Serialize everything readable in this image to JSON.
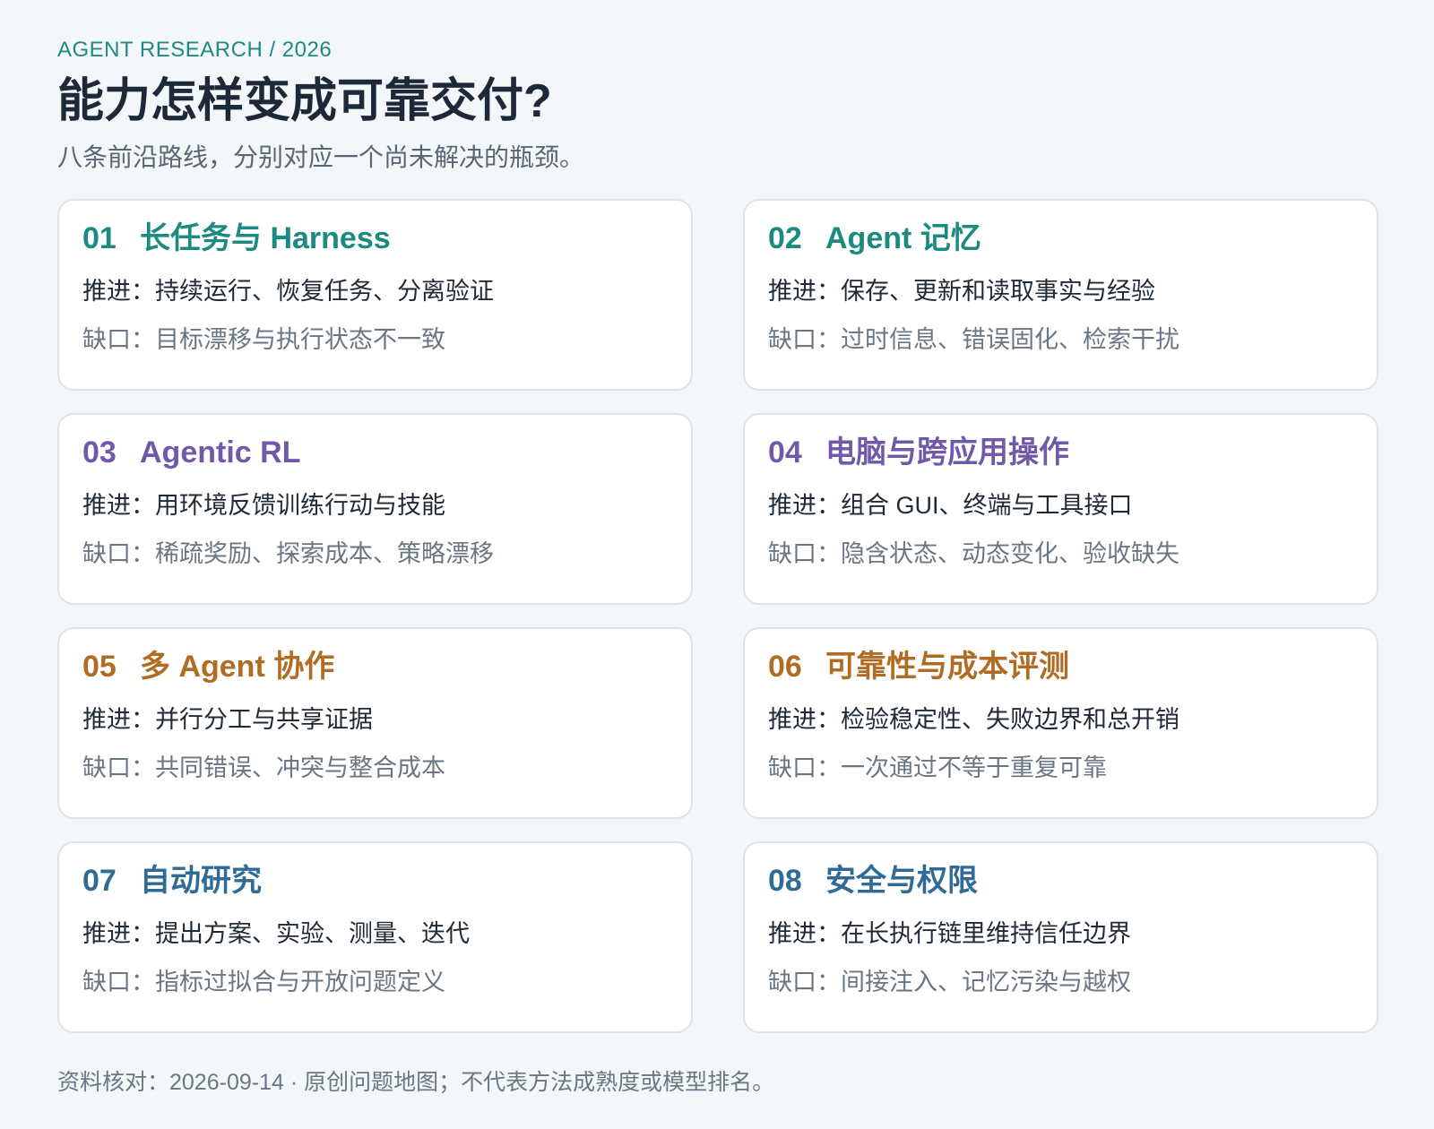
{
  "header": {
    "eyebrow": "AGENT RESEARCH / 2026",
    "title": "能力怎样变成可靠交付?",
    "subtitle": "八条前沿路线，分别对应一个尚未解决的瓶颈。"
  },
  "labels": {
    "push": "推进：",
    "gap": "缺口："
  },
  "cards": [
    {
      "num": "01",
      "title": "长任务与 Harness",
      "push": "持续运行、恢复任务、分离验证",
      "gap": "目标漂移与执行状态不一致",
      "accent": "#1b8a80"
    },
    {
      "num": "02",
      "title": "Agent 记忆",
      "push": "保存、更新和读取事实与经验",
      "gap": "过时信息、错误固化、检索干扰",
      "accent": "#1b8a80"
    },
    {
      "num": "03",
      "title": "Agentic RL",
      "push": "用环境反馈训练行动与技能",
      "gap": "稀疏奖励、探索成本、策略漂移",
      "accent": "#7059a8"
    },
    {
      "num": "04",
      "title": "电脑与跨应用操作",
      "push": "组合 GUI、终端与工具接口",
      "gap": "隐含状态、动态变化、验收缺失",
      "accent": "#7059a8"
    },
    {
      "num": "05",
      "title": "多 Agent 协作",
      "push": "并行分工与共享证据",
      "gap": "共同错误、冲突与整合成本",
      "accent": "#b06c22"
    },
    {
      "num": "06",
      "title": "可靠性与成本评测",
      "push": "检验稳定性、失败边界和总开销",
      "gap": "一次通过不等于重复可靠",
      "accent": "#b06c22"
    },
    {
      "num": "07",
      "title": "自动研究",
      "push": "提出方案、实验、测量、迭代",
      "gap": "指标过拟合与开放问题定义",
      "accent": "#2f6b96"
    },
    {
      "num": "08",
      "title": "安全与权限",
      "push": "在长执行链里维持信任边界",
      "gap": "间接注入、记忆污染与越权",
      "accent": "#2f6b96"
    }
  ],
  "footer": {
    "text": "资料核对：2026-09-14 · 原创问题地图；不代表方法成熟度或模型排名。"
  }
}
